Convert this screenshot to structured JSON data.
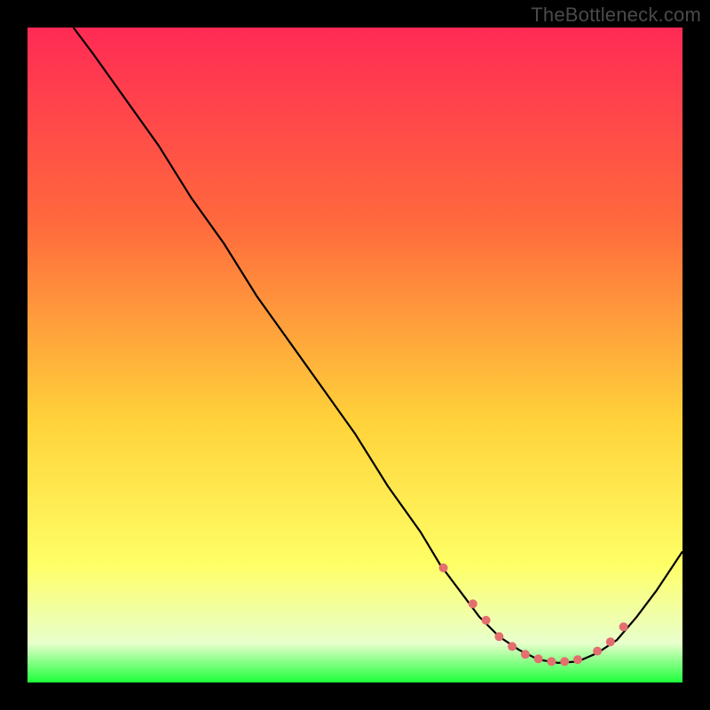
{
  "watermark": "TheBottleneck.com",
  "colors": {
    "frame": "#000000",
    "gradient_top": "#ff2a55",
    "gradient_mid1": "#ff6a3d",
    "gradient_mid2": "#ffd23a",
    "gradient_mid3": "#ffff66",
    "gradient_mid4": "#e8ffcc",
    "gradient_bottom": "#1eff3a",
    "curve": "#000000",
    "dots": "#e36f6f"
  },
  "chart_data": {
    "type": "line",
    "title": "",
    "xlabel": "",
    "ylabel": "",
    "xlim": [
      0,
      100
    ],
    "ylim": [
      0,
      100
    ],
    "series": [
      {
        "name": "curve",
        "x": [
          7,
          10,
          15,
          20,
          25,
          30,
          35,
          40,
          45,
          50,
          55,
          60,
          63,
          66,
          69,
          72,
          75,
          78,
          81,
          84,
          87,
          90,
          93,
          96,
          100
        ],
        "y": [
          100,
          96,
          89,
          82,
          74,
          67,
          59,
          52,
          45,
          38,
          30,
          23,
          18,
          14,
          10,
          7,
          5,
          3.5,
          3,
          3.2,
          4.5,
          6.5,
          10,
          14,
          20
        ]
      }
    ],
    "annotations": {
      "dots_x": [
        63.5,
        68,
        70,
        72,
        74,
        76,
        78,
        80,
        82,
        84,
        87,
        89,
        91
      ],
      "dots_y": [
        17.5,
        12,
        9.5,
        7,
        5.5,
        4.3,
        3.6,
        3.2,
        3.2,
        3.5,
        4.8,
        6.2,
        8.5
      ]
    }
  }
}
